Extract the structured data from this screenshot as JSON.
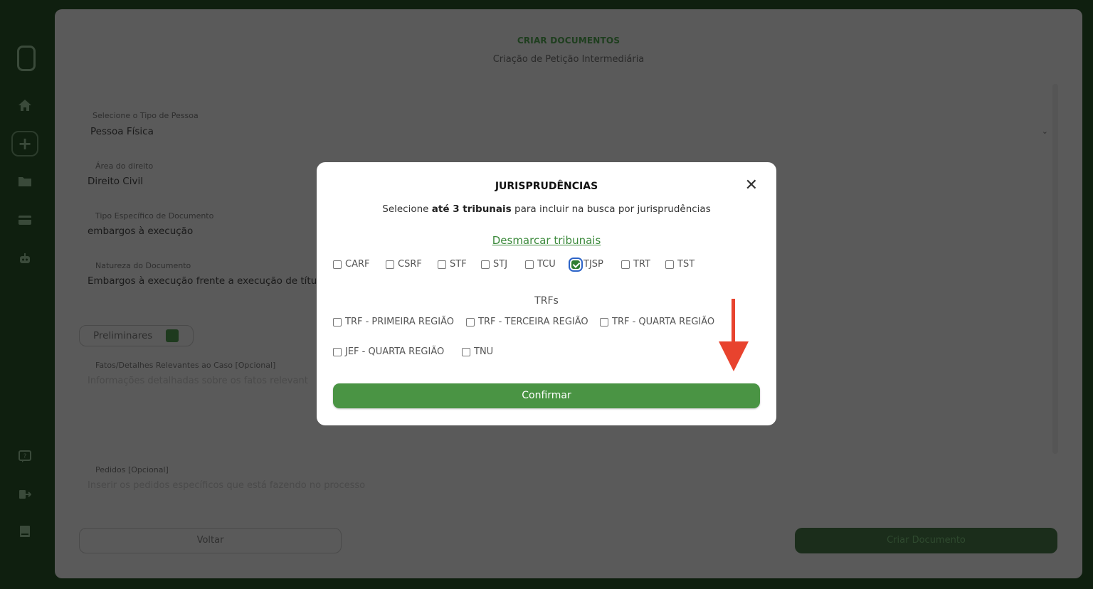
{
  "header": {
    "title": "CRIAR DOCUMENTOS",
    "subtitle": "Criação de Petição Intermediária"
  },
  "form": {
    "tipo_pessoa": {
      "label": "Selecione o Tipo de Pessoa",
      "value": "Pessoa Física"
    },
    "area": {
      "label": "Área do direito",
      "value": "Direito Civil"
    },
    "tipo_doc": {
      "label": "Tipo Específico de Documento",
      "value": "embargos à execução"
    },
    "natureza": {
      "label": "Natureza do Documento",
      "value": "Embargos à execução frente a execução de títu"
    },
    "preliminares": "Preliminares",
    "fatos": {
      "label": "Fatos/Detalhes Relevantes ao Caso [Opcional]",
      "placeholder": "Informações detalhadas sobre os fatos relevant"
    },
    "pedidos": {
      "label": "Pedidos [Opcional]",
      "placeholder": "Inserir os pedidos específicos que está fazendo no processo"
    },
    "voltar": "Voltar",
    "criar": "Criar Documento"
  },
  "modal": {
    "title": "JURISPRUDÊNCIAS",
    "subtitle_pre": "Selecione ",
    "subtitle_bold": "até 3 tribunais",
    "subtitle_post": " para incluir na busca por jurisprudências",
    "unselect": "Desmarcar tribunais",
    "close": "✕",
    "tribunais": [
      {
        "label": "CARF",
        "checked": false
      },
      {
        "label": "CSRF",
        "checked": false
      },
      {
        "label": "STF",
        "checked": false
      },
      {
        "label": "STJ",
        "checked": false
      },
      {
        "label": "TCU",
        "checked": false
      },
      {
        "label": "TJSP",
        "checked": true
      },
      {
        "label": "TRT",
        "checked": false
      },
      {
        "label": "TST",
        "checked": false
      }
    ],
    "trfs_title": "TRFs",
    "trfs": [
      {
        "label": "TRF - PRIMEIRA REGIÃO",
        "checked": false
      },
      {
        "label": "TRF - TERCEIRA REGIÃO",
        "checked": false
      },
      {
        "label": "TRF - QUARTA REGIÃO",
        "checked": false
      },
      {
        "label": "JEF - QUARTA REGIÃO",
        "checked": false
      },
      {
        "label": "TNU",
        "checked": false
      }
    ],
    "confirm": "Confirmar"
  },
  "colors": {
    "accent": "#4a9444",
    "arrow": "#e8432e"
  }
}
